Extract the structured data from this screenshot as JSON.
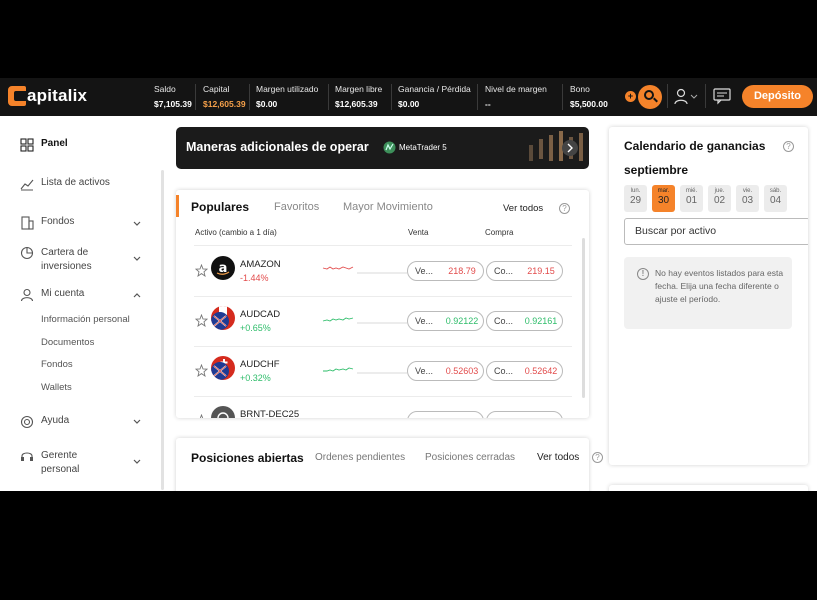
{
  "header": {
    "logo_text": "apitalix",
    "metrics": [
      {
        "label": "Saldo",
        "value": "$7,105.39"
      },
      {
        "label": "Capital",
        "value": "$12,605.39"
      },
      {
        "label": "Margen utilizado",
        "value": "$0.00"
      },
      {
        "label": "Margen libre",
        "value": "$12,605.39"
      },
      {
        "label": "Ganancia / Pérdida",
        "value": "$0.00"
      },
      {
        "label": "Nivel de margen",
        "value": "--"
      },
      {
        "label": "Bono",
        "value": "$5,500.00"
      }
    ],
    "plus_label": "+",
    "deposit_label": "Depósito",
    "accent_color": "#f5832a"
  },
  "sidebar": {
    "items": [
      {
        "label": "Panel"
      },
      {
        "label": "Lista de activos"
      },
      {
        "label": "Fondos"
      },
      {
        "label": "Cartera de inversiones"
      },
      {
        "label": "Mi cuenta"
      },
      {
        "label": "Ayuda"
      },
      {
        "label": "Gerente personal"
      }
    ],
    "subitems": [
      "Información personal",
      "Documentos",
      "Fondos",
      "Wallets"
    ]
  },
  "banner": {
    "title": "Maneras adicionales de operar",
    "platform": "MetaTrader 5"
  },
  "markets": {
    "tabs": [
      "Populares",
      "Favoritos",
      "Mayor Movimiento"
    ],
    "see_all": "Ver todos",
    "columns": {
      "asset": "Activo (cambio a 1 día)",
      "sell": "Venta",
      "buy": "Compra"
    },
    "rows": [
      {
        "name": "AMAZON",
        "change": "-1.44%",
        "sell_label": "Ve...",
        "sell": "218.79",
        "buy_label": "Co...",
        "buy": "219.15"
      },
      {
        "name": "AUDCAD",
        "change": "+0.65%",
        "sell_label": "Ve...",
        "sell": "0.92122",
        "buy_label": "Co...",
        "buy": "0.92161"
      },
      {
        "name": "AUDCHF",
        "change": "+0.32%",
        "sell_label": "Ve...",
        "sell": "0.52603",
        "buy_label": "Co...",
        "buy": "0.52642"
      },
      {
        "name": "BRNT-DEC25",
        "change": "",
        "sell_label": "",
        "sell": "",
        "buy_label": "",
        "buy": ""
      }
    ]
  },
  "positions": {
    "tabs": [
      "Posiciones abiertas",
      "Ordenes pendientes",
      "Posiciones cerradas"
    ],
    "see_all": "Ver todos"
  },
  "calendar": {
    "title": "Calendario de ganancias",
    "month": "septiembre",
    "days": [
      {
        "name": "lun.",
        "num": "29"
      },
      {
        "name": "mar.",
        "num": "30"
      },
      {
        "name": "mié.",
        "num": "01"
      },
      {
        "name": "jue.",
        "num": "02"
      },
      {
        "name": "vie.",
        "num": "03"
      },
      {
        "name": "sáb.",
        "num": "04"
      }
    ],
    "search_placeholder": "Buscar por activo",
    "empty_text": "No hay eventos listados para esta fecha. Elija una fecha diferente o ajuste el período."
  }
}
